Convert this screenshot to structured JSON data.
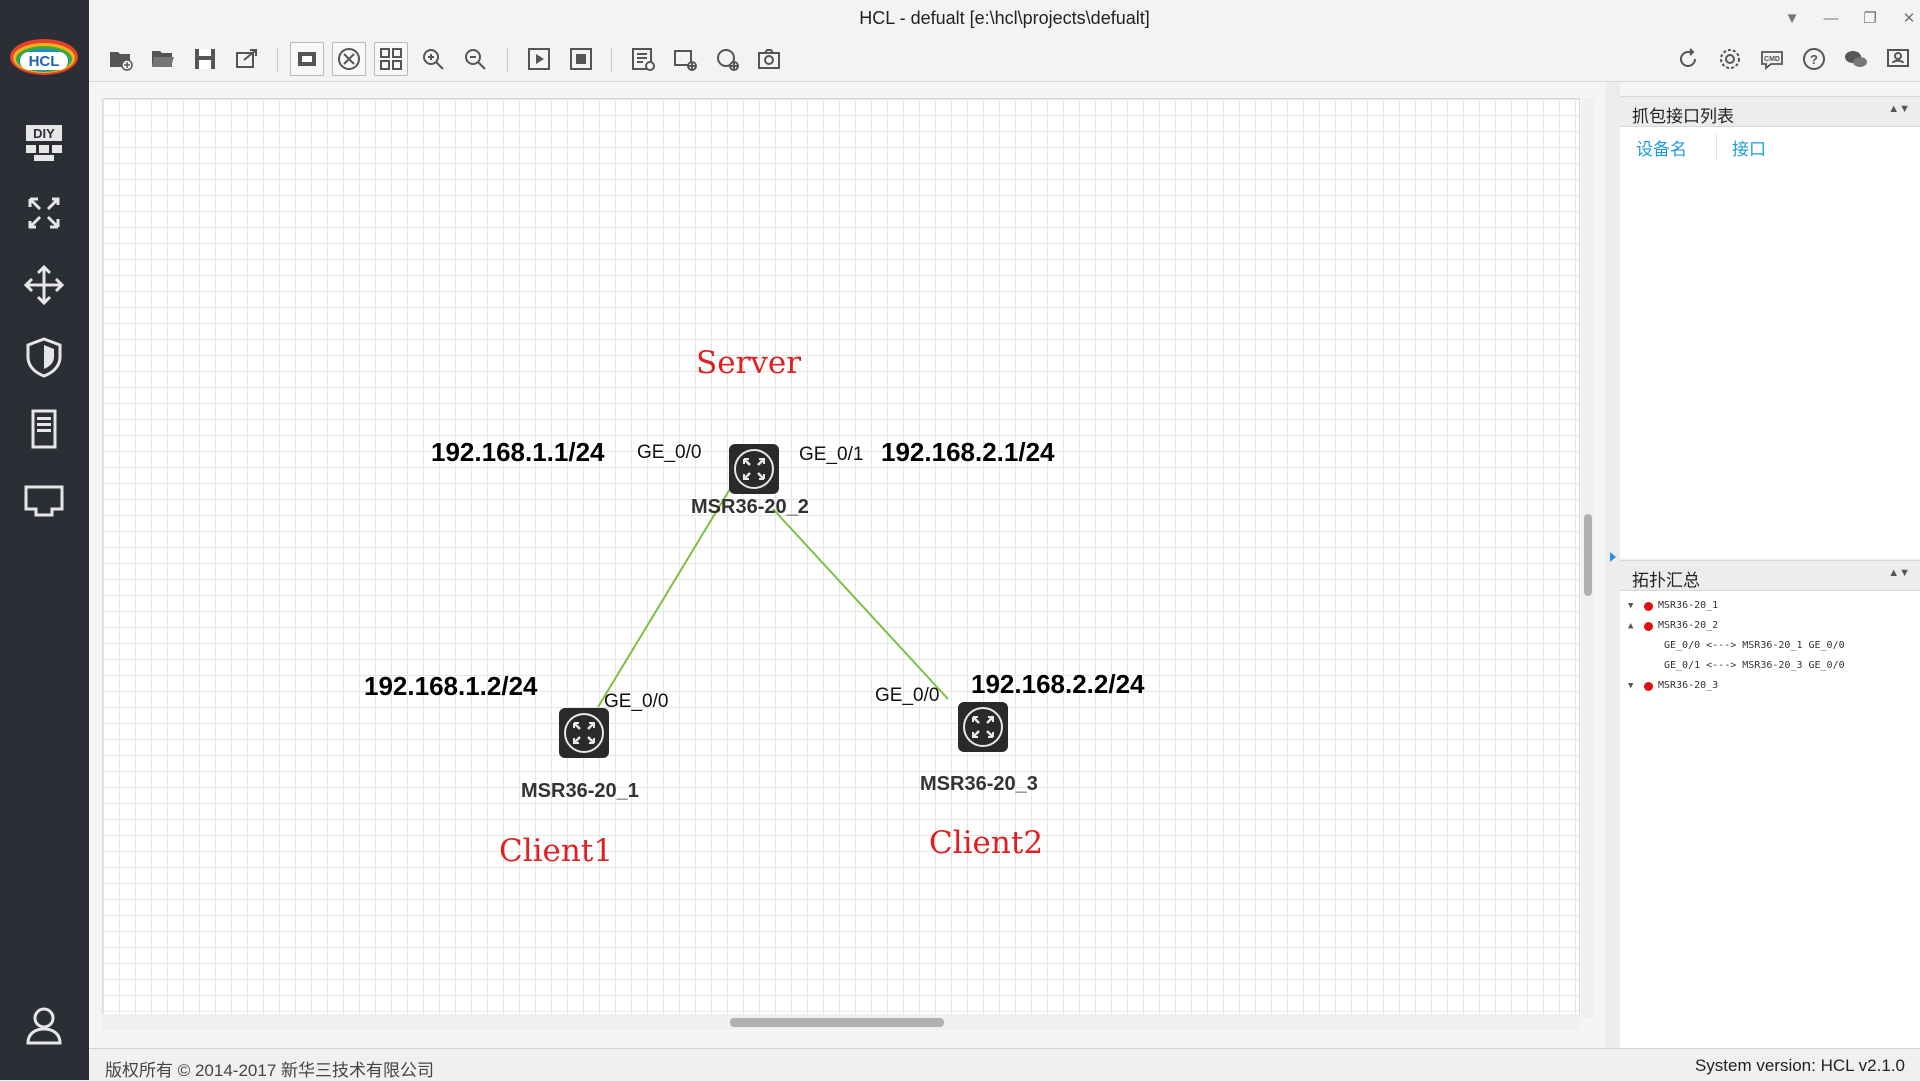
{
  "window": {
    "title": "HCL - defualt [e:\\hcl\\projects\\defualt]",
    "controls": [
      "dropdown-icon",
      "minimize-icon",
      "restore-icon",
      "close-icon"
    ]
  },
  "logo": {
    "text": "HCL"
  },
  "sidebar": {
    "items": [
      {
        "icon": "diy-icon"
      },
      {
        "icon": "router-icon"
      },
      {
        "icon": "switch-icon"
      },
      {
        "icon": "firewall-icon"
      },
      {
        "icon": "server-icon"
      },
      {
        "icon": "network-port-icon"
      },
      {
        "icon": "user-icon"
      }
    ]
  },
  "toolbar": {
    "left": [
      "new-project-icon",
      "open-project-icon",
      "save-icon",
      "export-icon",
      "show-interface-icon",
      "device-icon",
      "grid-icon",
      "zoom-in-icon",
      "zoom-out-icon",
      "start-icon",
      "stop-icon",
      "notes-icon",
      "add-shape-icon",
      "refresh-device-icon",
      "snapshot-icon"
    ],
    "right": [
      "reset-icon",
      "settings-icon",
      "cmd-icon",
      "help-icon",
      "wechat-icon",
      "feedback-icon"
    ]
  },
  "topology": {
    "nodes": [
      {
        "id": "r2",
        "name": "MSR36-20_2"
      },
      {
        "id": "r1",
        "name": "MSR36-20_1"
      },
      {
        "id": "r3",
        "name": "MSR36-20_3"
      }
    ],
    "ports": {
      "r2_left": "GE_0/0",
      "r2_right": "GE_0/1",
      "r1": "GE_0/0",
      "r3": "GE_0/0"
    },
    "ips": {
      "r2_left": "192.168.1.1/24",
      "r2_right": "192.168.2.1/24",
      "r1": "192.168.1.2/24",
      "r3": "192.168.2.2/24"
    },
    "notes": {
      "server": "Server",
      "client1": "Client1",
      "client2": "Client2"
    },
    "link_color": "#7ac142"
  },
  "capture_panel": {
    "title": "抓包接口列表",
    "columns": [
      "设备名",
      "接口"
    ]
  },
  "topology_summary": {
    "title": "拓扑汇总",
    "rows": [
      {
        "toggle": "▼",
        "device": "MSR36-20_1"
      },
      {
        "toggle": "▲",
        "device": "MSR36-20_2"
      },
      {
        "child": "GE_0/0 <---> MSR36-20_1 GE_0/0"
      },
      {
        "child": "GE_0/1 <---> MSR36-20_3 GE_0/0"
      },
      {
        "toggle": "▼",
        "device": "MSR36-20_3"
      }
    ]
  },
  "status": {
    "copyright": "版权所有 © 2014-2017 新华三技术有限公司",
    "version": "System version: HCL v2.1.0"
  }
}
